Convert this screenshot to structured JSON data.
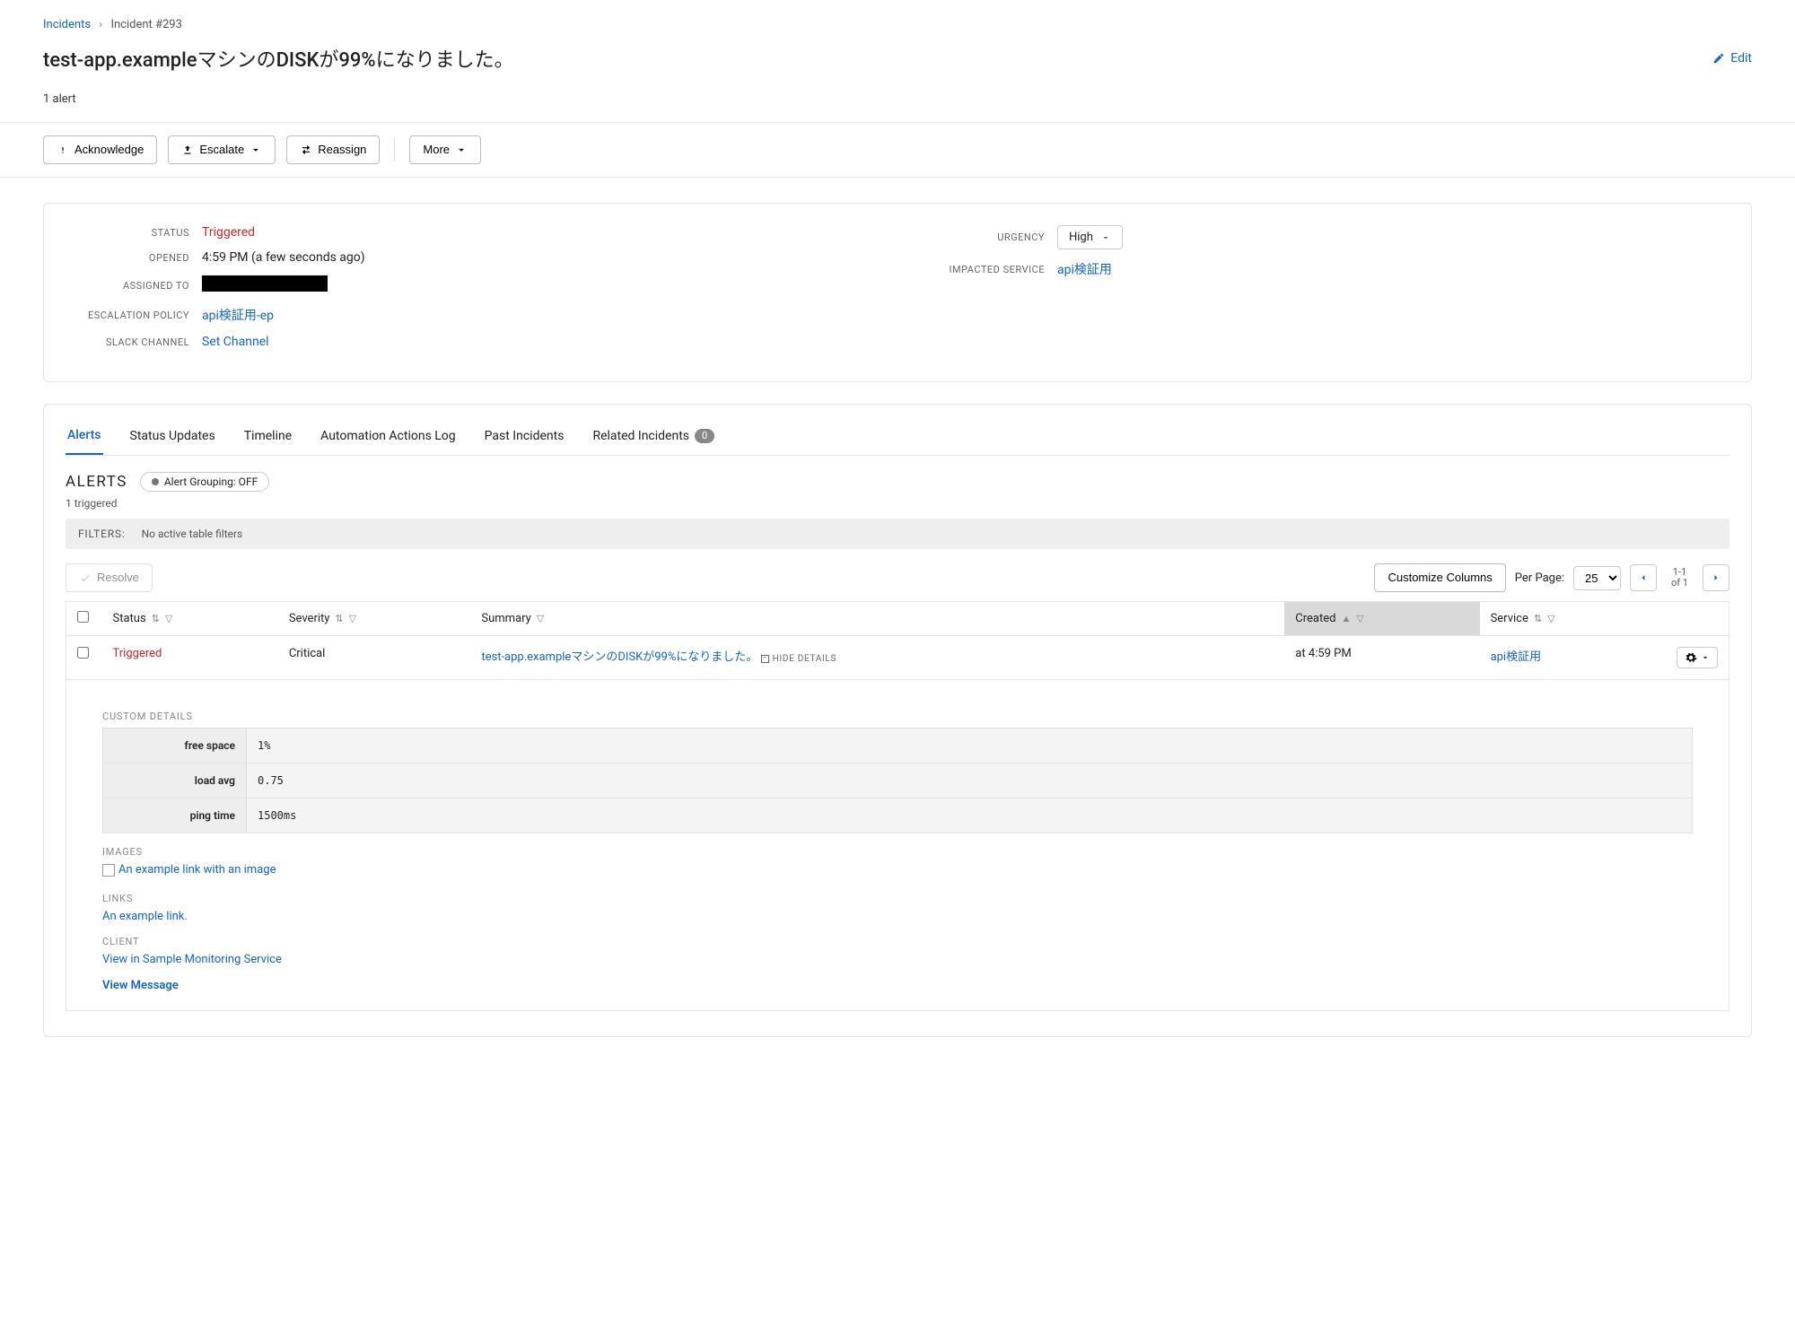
{
  "breadcrumb": {
    "root": "Incidents",
    "current": "Incident #293"
  },
  "title": "test-app.exampleマシンのDISKが99%になりました。",
  "alertcount": "1 alert",
  "edit_label": "Edit",
  "actions": {
    "acknowledge": "Acknowledge",
    "escalate": "Escalate",
    "reassign": "Reassign",
    "more": "More"
  },
  "meta": {
    "status_label": "STATUS",
    "status_value": "Triggered",
    "opened_label": "OPENED",
    "opened_value": "4:59 PM (a few seconds ago)",
    "assigned_label": "ASSIGNED TO",
    "escpol_label": "ESCALATION POLICY",
    "escpol_value": "api検証用-ep",
    "slack_label": "SLACK CHANNEL",
    "slack_value": "Set Channel",
    "urgency_label": "URGENCY",
    "urgency_value": "High",
    "impacted_label": "IMPACTED SERVICE",
    "impacted_value": "api検証用"
  },
  "tabs": {
    "alerts": "Alerts",
    "status": "Status Updates",
    "timeline": "Timeline",
    "automation": "Automation Actions Log",
    "past": "Past Incidents",
    "related": "Related Incidents",
    "related_count": "0"
  },
  "alerts_section": {
    "heading": "ALERTS",
    "grouping": "Alert Grouping: OFF",
    "triggered": "1 triggered",
    "filters_label": "FILTERS:",
    "filters_text": "No active table filters",
    "resolve": "Resolve",
    "customize": "Customize Columns",
    "per_page_label": "Per Page:",
    "per_page_value": "25",
    "range": "1-1",
    "of": "of 1"
  },
  "table": {
    "headers": {
      "status": "Status",
      "severity": "Severity",
      "summary": "Summary",
      "created": "Created",
      "service": "Service"
    },
    "row": {
      "status": "Triggered",
      "severity": "Critical",
      "summary": "test-app.exampleマシンのDISKが99%になりました。",
      "hide_details": "HIDE DETAILS",
      "created": "at 4:59 PM",
      "service": "api検証用"
    }
  },
  "details": {
    "custom_label": "CUSTOM DETAILS",
    "kv": [
      {
        "k": "free space",
        "v": "1%"
      },
      {
        "k": "load avg",
        "v": "0.75"
      },
      {
        "k": "ping time",
        "v": "1500ms"
      }
    ],
    "images_label": "IMAGES",
    "image_alt": "An example link with an image",
    "links_label": "LINKS",
    "link_text": "An example link.",
    "client_label": "CLIENT",
    "client_text": "View in Sample Monitoring Service",
    "view_message": "View Message"
  }
}
